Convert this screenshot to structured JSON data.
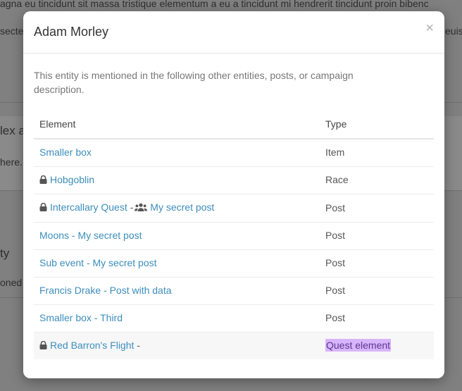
{
  "background": {
    "line1": "agna eu tincidunt sit massa tristique elementum a eu a tincidunt mi hendrerit tincidunt proin bibenc",
    "line2_left": "secte",
    "line2_right": "euis",
    "frag1": "lex a",
    "frag2": "here.",
    "frag3": "ty",
    "frag4": "oned"
  },
  "modal": {
    "title": "Adam Morley",
    "close_label": "×",
    "intro": "This entity is mentioned in the following other entities, posts, or campaign description.",
    "table": {
      "headers": {
        "element": "Element",
        "type": "Type"
      },
      "rows": [
        {
          "lock": false,
          "link": "Smaller box",
          "type": "Item"
        },
        {
          "lock": true,
          "link": "Hobgoblin",
          "type": "Race"
        },
        {
          "lock": true,
          "link": "Intercallary Quest",
          "sep": "-",
          "post": "My secret post",
          "type": "Post"
        },
        {
          "lock": false,
          "link": "Moons - My secret post",
          "type": "Post"
        },
        {
          "lock": false,
          "link": "Sub event - My secret post",
          "type": "Post"
        },
        {
          "lock": false,
          "link": "Francis Drake - Post with data",
          "type": "Post"
        },
        {
          "lock": false,
          "link": "Smaller box - Third",
          "type": "Post"
        },
        {
          "lock": true,
          "link": "Red Barron's Flight",
          "sep": "-",
          "type": "Quest element"
        }
      ]
    }
  },
  "colors": {
    "link": "#3c8dbc",
    "highlight": "#d8b4fe",
    "overlay": "#808080"
  }
}
